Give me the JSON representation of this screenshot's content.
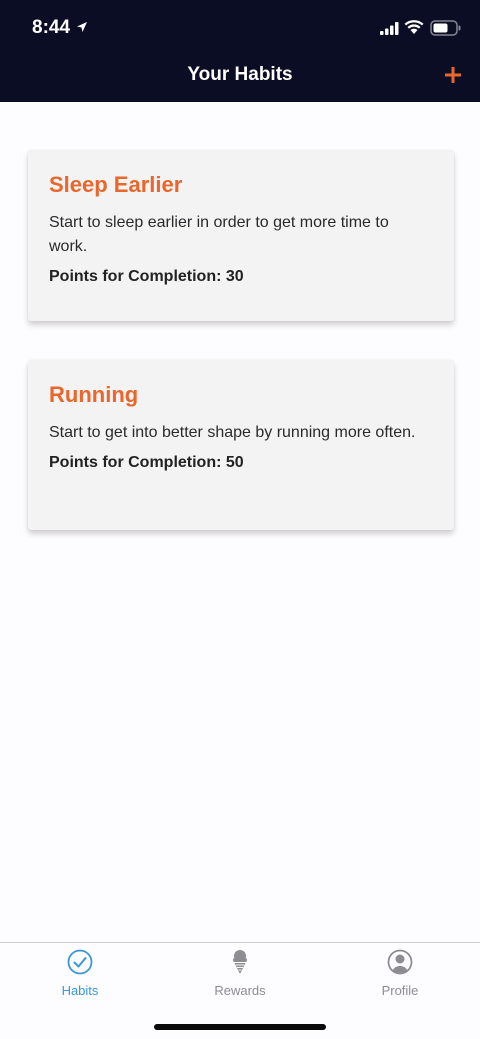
{
  "status_bar": {
    "time": "8:44"
  },
  "header": {
    "title": "Your Habits",
    "add_icon": "plus-icon"
  },
  "habits": [
    {
      "title": "Sleep Earlier",
      "description": "Start to sleep earlier in order to get more time to work.",
      "points_label": "Points for Completion: 30"
    },
    {
      "title": "Running",
      "description": "Start to get into better shape by running more often.",
      "points_label": "Points for Completion: 50"
    }
  ],
  "tabs": [
    {
      "label": "Habits",
      "icon": "check-circle-icon",
      "active": true
    },
    {
      "label": "Rewards",
      "icon": "ice-cream-icon",
      "active": false
    },
    {
      "label": "Profile",
      "icon": "user-circle-icon",
      "active": false
    }
  ],
  "colors": {
    "header_bg": "#0b0d24",
    "accent": "#e9672c",
    "active_tab": "#3a98d8",
    "inactive_tab": "#8d8d92"
  }
}
